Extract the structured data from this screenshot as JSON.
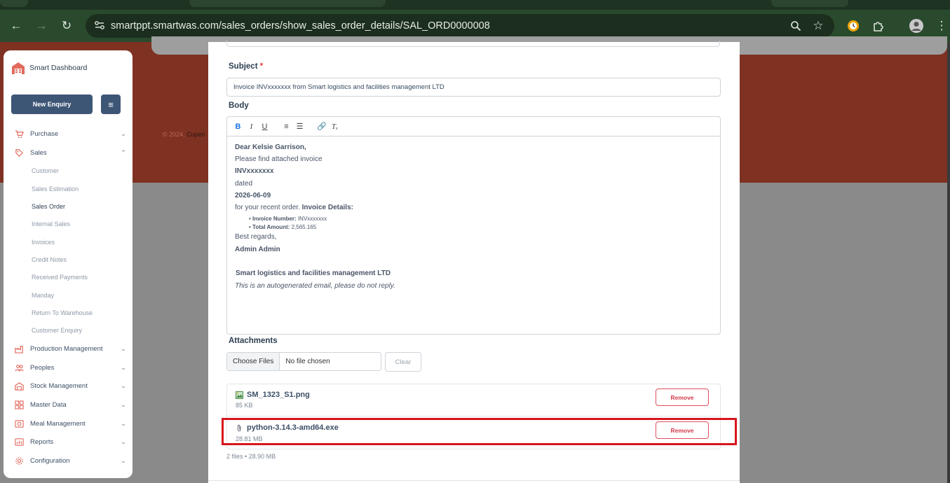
{
  "browser": {
    "url": "smartppt.smartwas.com/sales_orders/show_sales_order_details/SAL_ORD0000008"
  },
  "footer": {
    "copyright_prefix": "© 2024, ",
    "copyright_name": "Cupen"
  },
  "sidebar": {
    "brand": "Smart Dashboard",
    "new_enquiry": "New Enquiry",
    "sections": {
      "purchase": "Purchase",
      "sales": "Sales",
      "production": "Production Management",
      "peoples": "Peoples",
      "stock": "Stock Management",
      "master": "Master Data",
      "meal": "Meal Management",
      "reports": "Reports",
      "config": "Configuration"
    },
    "sales_items": {
      "customer": "Customer",
      "estimation": "Sales Estimation",
      "order": "Sales Order",
      "internal": "Internal Sales",
      "invoices": "Invoices",
      "credit": "Credit Notes",
      "payments": "Received Payments",
      "manday": "Manday",
      "return": "Return To Warehouse",
      "enquiry": "Customer Enquiry"
    }
  },
  "email": {
    "subject_label": "Subject",
    "required_mark": "*",
    "subject_value": "Invoice INVxxxxxxx from Smart logistics and facilities management LTD",
    "body_label": "Body",
    "body": {
      "greeting": "Dear Kelsie Garrison,",
      "line1": " Please find attached invoice",
      "invoice_no": "INVxxxxxxx",
      "dated": "dated",
      "date": "2026-06-09",
      "recent_order": "for your recent order. ",
      "details_heading": "Invoice Details:",
      "inv_number_label": "• Invoice Number: ",
      "inv_number_value": "INVxxxxxxx",
      "total_label": "• Total Amount: ",
      "total_value": "2,565.165",
      "regards": "Best regards,",
      "sender": "Admin Admin",
      "company": "Smart logistics and facilities management LTD",
      "disclaimer": "This is an autogenerated email, please do not reply."
    },
    "attachments_label": "Attachments",
    "choose_files": "Choose Files",
    "no_file": "No file chosen",
    "clear": "Clear",
    "files": [
      {
        "name": "SM_1323_S1.png",
        "size": "85 KB",
        "remove": "Remove"
      },
      {
        "name": "python-3.14.3-amd64.exe",
        "size": "28.81 MB",
        "remove": "Remove"
      }
    ],
    "summary": "2 files • 28.90 MB"
  }
}
